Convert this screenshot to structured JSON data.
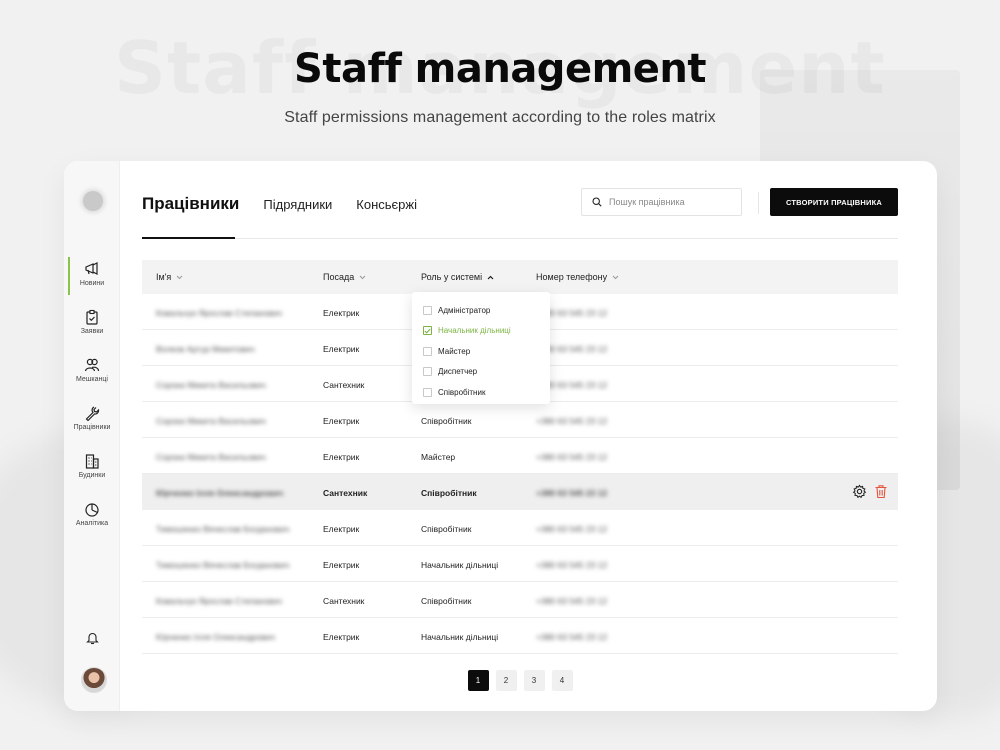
{
  "hero": {
    "ghost_title": "Staff management",
    "title": "Staff management",
    "subtitle": "Staff permissions management according to the roles matrix"
  },
  "sidebar": {
    "items": [
      {
        "label": "Новини",
        "icon": "megaphone-icon",
        "active": true
      },
      {
        "label": "Заявки",
        "icon": "clipboard-icon",
        "active": false
      },
      {
        "label": "Мешканці",
        "icon": "users-icon",
        "active": false
      },
      {
        "label": "Працівники",
        "icon": "wrench-icon",
        "active": false
      },
      {
        "label": "Будинки",
        "icon": "building-icon",
        "active": false
      },
      {
        "label": "Аналітика",
        "icon": "pie-chart-icon",
        "active": false
      }
    ]
  },
  "tabs": [
    {
      "label": "Працівники",
      "active": true
    },
    {
      "label": "Підрядники",
      "active": false
    },
    {
      "label": "Консьєржі",
      "active": false
    }
  ],
  "search": {
    "placeholder": "Пошук працівника"
  },
  "create_button": "СТВОРИТИ ПРАЦІВНИКА",
  "table": {
    "headers": {
      "name": "Ім'я",
      "position": "Посада",
      "role": "Роль у системі",
      "phone": "Номер телефону"
    },
    "rows": [
      {
        "name": "Ковальчук Ярослав Степанович",
        "position": "Електрик",
        "role": "",
        "phone": "+380 63 545 23 12"
      },
      {
        "name": "Волков Артур Микитович",
        "position": "Електрик",
        "role": "",
        "phone": "+380 63 545 23 12"
      },
      {
        "name": "Сорока Микита Васильович",
        "position": "Сантехник",
        "role": "",
        "phone": "+380 63 545 23 12"
      },
      {
        "name": "Сорока Микита Васильович",
        "position": "Електрик",
        "role": "Співробітник",
        "phone": "+380 63 545 23 12"
      },
      {
        "name": "Сорока Микита Васильович",
        "position": "Електрик",
        "role": "Майстер",
        "phone": "+380 63 545 23 12"
      },
      {
        "name": "Юрченко Ілля Олександрович",
        "position": "Сантехник",
        "role": "Співробітник",
        "phone": "+380 63 545 23 12",
        "selected": true
      },
      {
        "name": "Тимошенко Вячеслав Богданович",
        "position": "Електрик",
        "role": "Співробітник",
        "phone": "+380 63 545 23 12"
      },
      {
        "name": "Тимошенко Вячеслав Богданович",
        "position": "Електрик",
        "role": "Начальник дільниці",
        "phone": "+380 63 545 23 12"
      },
      {
        "name": "Ковальчук Ярослав Степанович",
        "position": "Сантехник",
        "role": "Співробітник",
        "phone": "+380 63 545 23 12"
      },
      {
        "name": "Юрченко Ілля Олександрович",
        "position": "Електрик",
        "role": "Начальник дільниці",
        "phone": "+380 63 545 23 12"
      }
    ]
  },
  "role_filter": {
    "options": [
      {
        "label": "Адміністратор",
        "checked": false
      },
      {
        "label": "Начальник дільниці",
        "checked": true
      },
      {
        "label": "Майстер",
        "checked": false
      },
      {
        "label": "Диспетчер",
        "checked": false
      },
      {
        "label": "Співробітник",
        "checked": false
      }
    ]
  },
  "pagination": {
    "pages": [
      "1",
      "2",
      "3",
      "4"
    ],
    "current": "1"
  },
  "colors": {
    "accent": "#7cb342",
    "primary": "#0c0c0c",
    "danger": "#e5533d"
  }
}
